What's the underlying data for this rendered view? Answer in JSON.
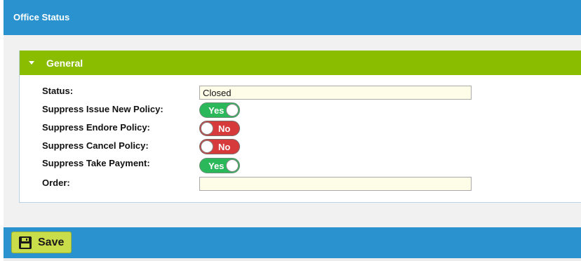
{
  "header": {
    "title": "Office Status"
  },
  "section": {
    "title": "General"
  },
  "form": {
    "status": {
      "label": "Status:",
      "value": "Closed"
    },
    "suppress_issue_new_policy": {
      "label": "Suppress Issue New Policy:",
      "state": "Yes"
    },
    "suppress_endore_policy": {
      "label": "Suppress Endore Policy:",
      "state": "No"
    },
    "suppress_cancel_policy": {
      "label": "Suppress Cancel Policy:",
      "state": "No"
    },
    "suppress_take_payment": {
      "label": "Suppress Take Payment:",
      "state": "Yes"
    },
    "order": {
      "label": "Order:",
      "value": ""
    }
  },
  "footer": {
    "save_label": "Save"
  },
  "colors": {
    "header_blue": "#2a92ce",
    "section_green": "#8abd00",
    "toggle_on": "#2bb85a",
    "toggle_off": "#d63a3a",
    "save_button": "#c9dc4a",
    "input_background": "#fdfde8"
  },
  "icons": {
    "section_toggle": "caret-down-icon",
    "save": "floppy-disk-icon"
  }
}
